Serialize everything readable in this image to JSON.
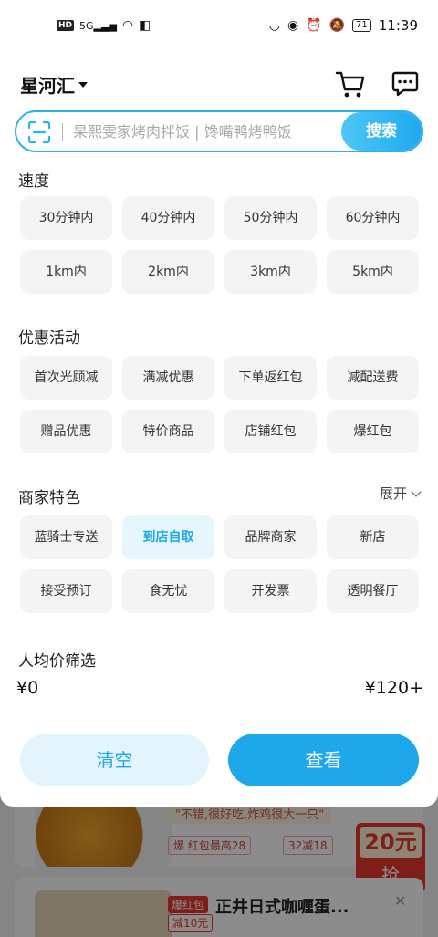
{
  "status_bar": {
    "left_badge": "HD",
    "signal": "5G",
    "battery": "71",
    "time": "11:39"
  },
  "header": {
    "location": "星河汇",
    "cart_icon": "cart-icon",
    "message_icon": "message-icon"
  },
  "search": {
    "placeholder": "杲熙雯家烤肉拌饭 | 馋嘴鸭烤鸭饭",
    "button_label": "搜索",
    "accent_color": "#1fa9ee"
  },
  "filters": {
    "speed": {
      "title": "速度",
      "options": [
        "30分钟内",
        "40分钟内",
        "50分钟内",
        "60分钟内",
        "1km内",
        "2km内",
        "3km内",
        "5km内"
      ]
    },
    "promotions": {
      "title": "优惠活动",
      "options": [
        "首次光顾减",
        "满减优惠",
        "下单返红包",
        "减配送费",
        "赠品优惠",
        "特价商品",
        "店铺红包",
        "爆红包"
      ]
    },
    "features": {
      "title": "商家特色",
      "expand_label": "展开",
      "selected": "到店自取",
      "options": [
        "蓝骑士专送",
        "到店自取",
        "品牌商家",
        "新店",
        "接受预订",
        "食无忧",
        "开发票",
        "透明餐厅"
      ]
    },
    "price": {
      "title": "人均价筛选",
      "min_label": "¥0",
      "max_label": "¥120+"
    }
  },
  "actions": {
    "clear_label": "清空",
    "view_label": "查看"
  },
  "background_list": {
    "card1_quote": "\"不错,很好吃,炸鸡很大一只\"",
    "card1_tag1": "爆 红包最高28",
    "card1_tag2": "32减18",
    "card1_coupon_amount": "20元",
    "card1_coupon_action": "抢",
    "card2_badge": "爆红包",
    "card2_badge2": "减10元",
    "card2_title": "正井日式咖喱蛋..."
  }
}
